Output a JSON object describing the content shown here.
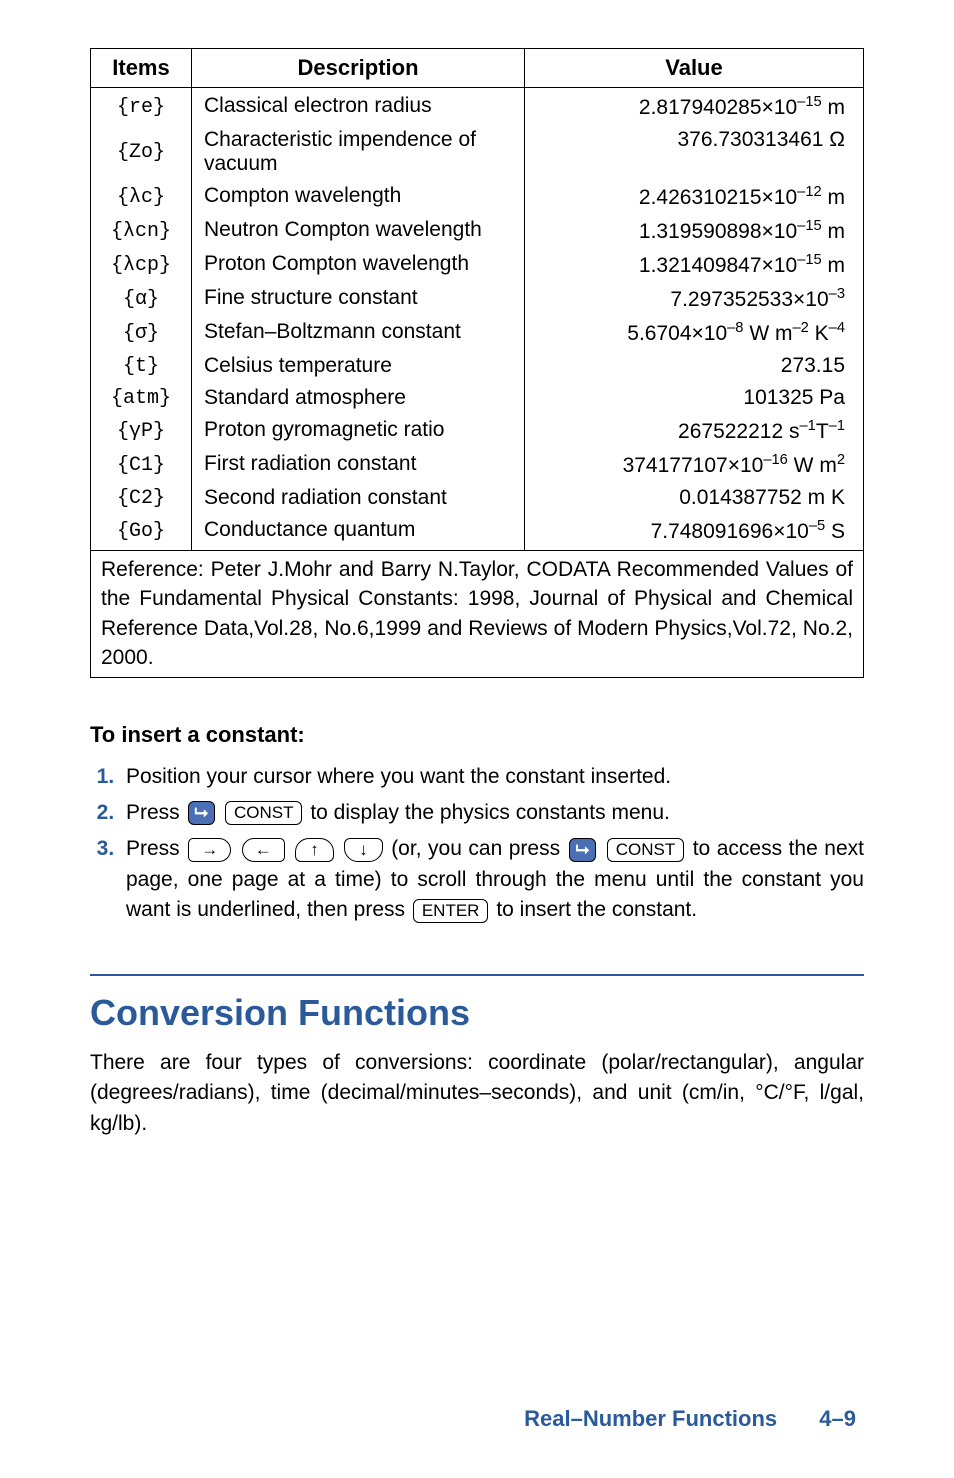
{
  "table": {
    "headers": {
      "items": "Items",
      "description": "Description",
      "value": "Value"
    },
    "rows": [
      {
        "item": "{re}",
        "desc": "Classical electron radius",
        "value": "2.817940285×10<sup>–15</sup> m"
      },
      {
        "item": "{Zo}",
        "desc": "Characteristic impendence of vacuum",
        "value": "376.730313461 Ω"
      },
      {
        "item": "{λc}",
        "desc": "Compton wavelength",
        "value": "2.426310215×10<sup>–12</sup> m"
      },
      {
        "item": "{λcn}",
        "desc": "Neutron Compton wavelength",
        "value": "1.319590898×10<sup>–15</sup> m"
      },
      {
        "item": "{λcp}",
        "desc": "Proton Compton wavelength",
        "value": "1.321409847×10<sup>–15</sup> m"
      },
      {
        "item": "{α}",
        "desc": "Fine structure constant",
        "value": "7.297352533×10<sup>–3</sup>"
      },
      {
        "item": "{σ}",
        "desc": "Stefan–Boltzmann constant",
        "value": "5.6704×10<sup>–8</sup> W m<sup>–2</sup> K<sup>–4</sup>"
      },
      {
        "item": "{t}",
        "desc": "Celsius temperature",
        "value": "273.15"
      },
      {
        "item": "{atm}",
        "desc": "Standard atmosphere",
        "value": "101325 Pa"
      },
      {
        "item": "{γP}",
        "desc": "Proton gyromagnetic ratio",
        "value": "267522212 s<sup>–1</sup>T<sup>–1</sup>"
      },
      {
        "item": "{C1}",
        "desc": "First radiation constant",
        "value": "374177107×10<sup>–16</sup> W m<sup>2</sup>"
      },
      {
        "item": "{C2}",
        "desc": "Second radiation constant",
        "value": "0.014387752 m K"
      },
      {
        "item": "{Go}",
        "desc": "Conductance quantum",
        "value": "7.748091696×10<sup>–5</sup> S"
      }
    ],
    "reference": "Reference: Peter J.Mohr and Barry N.Taylor, CODATA Recommended Values of the Fundamental Physical Constants: 1998, Journal of Physical and Chemical Reference Data,Vol.28, No.6,1999 and Reviews of Modern Physics,Vol.72, No.2, 2000."
  },
  "howto": {
    "heading": "To insert a constant:",
    "steps": {
      "s1": "Position your cursor where you want the constant inserted.",
      "s2a": "Press ",
      "s2b": " to display the physics constants menu.",
      "s3a": "Press ",
      "s3b": " (or, you can press ",
      "s3c": " to access the next page, one page at a time) to scroll through the menu until the constant you want is underlined, then press ",
      "s3d": " to insert the constant."
    },
    "keys": {
      "shift": "⮡",
      "const": "CONST",
      "right": "→",
      "left": "←",
      "up": "↑",
      "down": "↓",
      "enter": "ENTER"
    }
  },
  "section": {
    "title": "Conversion Functions",
    "body": "There are four types of conversions: coordinate (polar/rectangular), angular (degrees/radians), time (decimal/minutes–seconds), and unit (cm/in, °C/°F, l/gal, kg/lb)."
  },
  "footer": {
    "chapter": "Real–Number Functions",
    "page": "4–9"
  }
}
